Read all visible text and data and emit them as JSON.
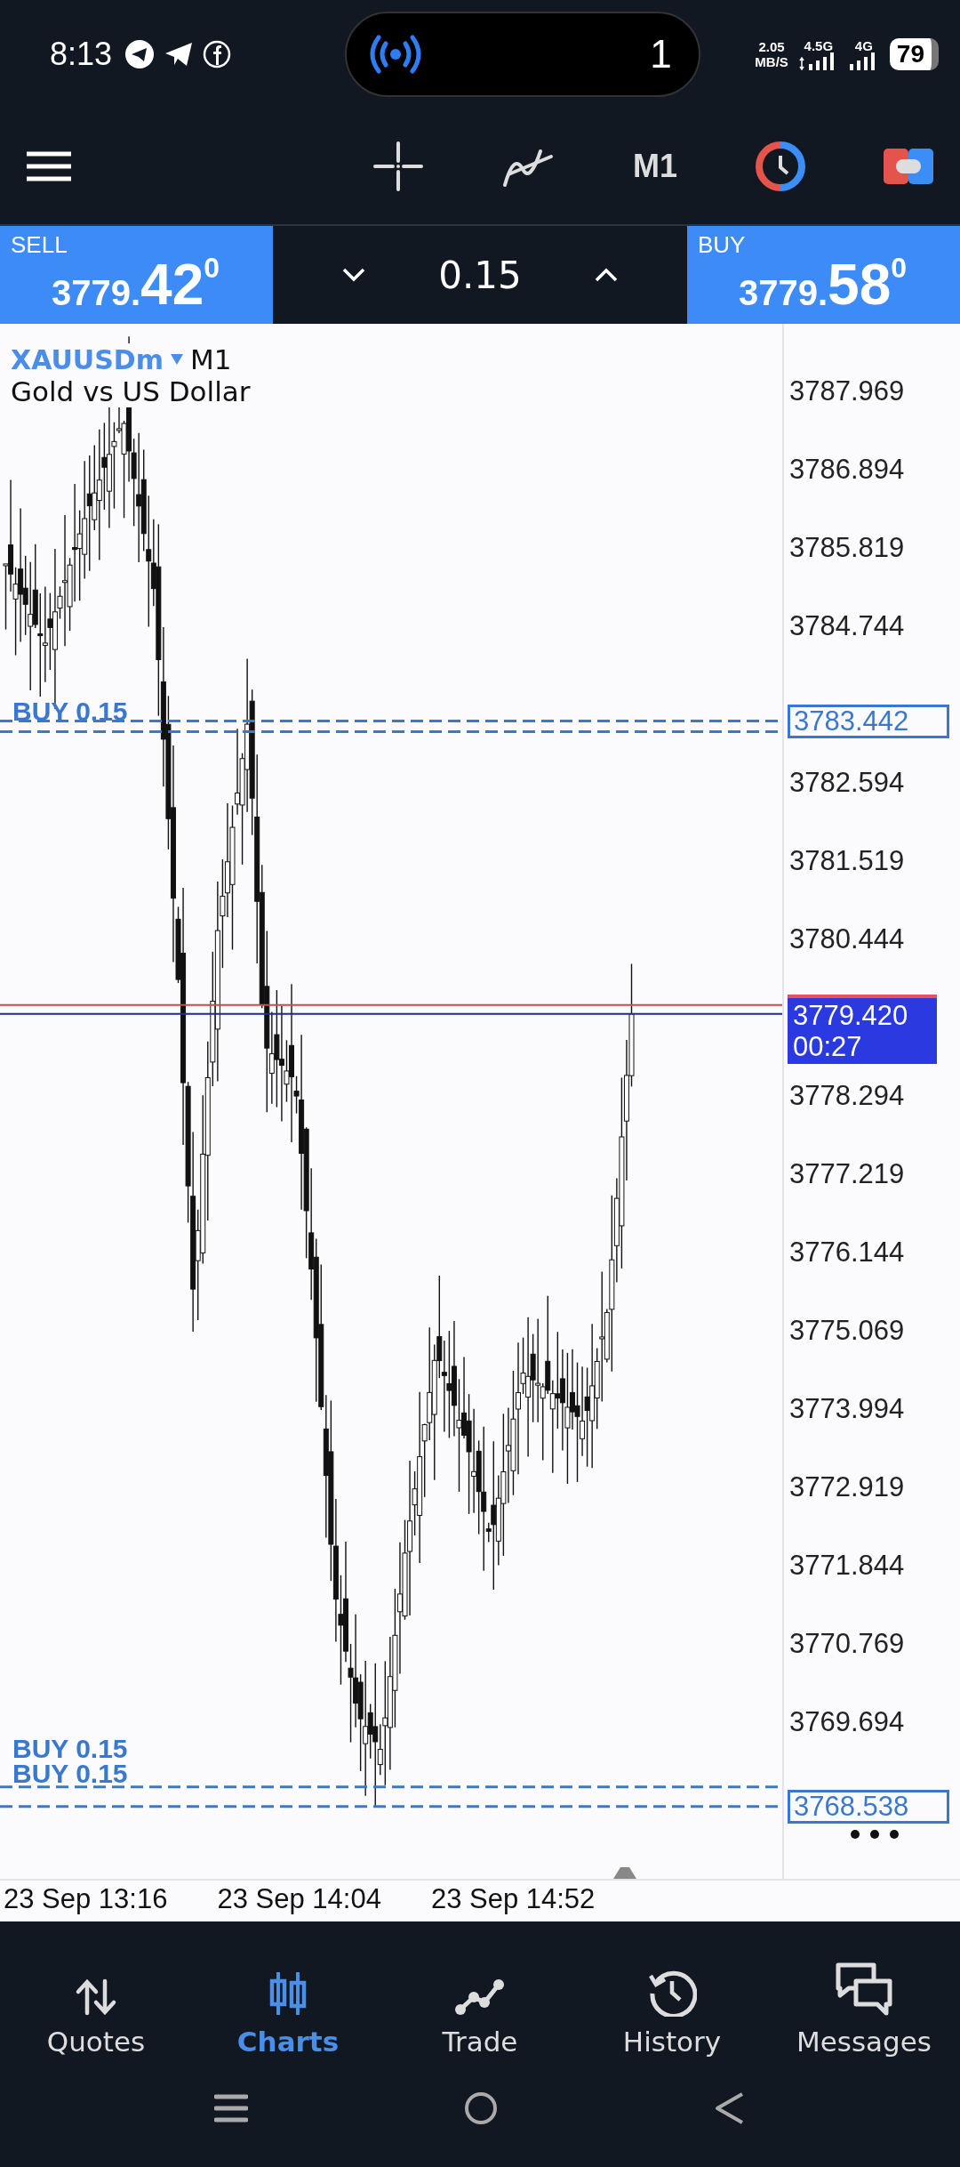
{
  "status_bar": {
    "time": "8:13",
    "pill_count": "1",
    "speed_value": "2.05",
    "speed_unit": "MB/S",
    "network_1": "4.5G",
    "network_2": "4G",
    "battery": "79"
  },
  "toolbar": {
    "timeframe": "M1"
  },
  "trade_bar": {
    "sell": {
      "label": "SELL",
      "price_small": "3779.",
      "price_big": "42",
      "price_sup": "0"
    },
    "volume": "0.15",
    "buy": {
      "label": "BUY",
      "price_small": "3779.",
      "price_big": "58",
      "price_sup": "0"
    }
  },
  "chart": {
    "symbol": "XAUUSDm",
    "timeframe": "M1",
    "description": "Gold vs US Dollar",
    "price_ticks": [
      "3787.969",
      "3786.894",
      "3785.819",
      "3784.744",
      "3782.594",
      "3781.519",
      "3780.444",
      "3778.294",
      "3777.219",
      "3776.144",
      "3775.069",
      "3773.994",
      "3772.919",
      "3771.844",
      "3770.769",
      "3769.694"
    ],
    "order_lines": [
      {
        "kind": "pair_below",
        "price": "3783.442",
        "labels": [
          "BUY 0.15"
        ]
      },
      {
        "kind": "pair_above",
        "price": "3768.538",
        "labels": [
          "BUY 0.15",
          "BUY 0.15"
        ]
      }
    ],
    "bid": {
      "price": "3779.420",
      "countdown": "00:27"
    },
    "time_ticks": [
      "23 Sep 13:16",
      "23 Sep 14:04",
      "23 Sep 14:52"
    ]
  },
  "nav": [
    {
      "label": "Quotes",
      "selected": false
    },
    {
      "label": "Charts",
      "selected": true
    },
    {
      "label": "Trade",
      "selected": false
    },
    {
      "label": "History",
      "selected": false
    },
    {
      "label": "Messages",
      "selected": false
    }
  ]
}
